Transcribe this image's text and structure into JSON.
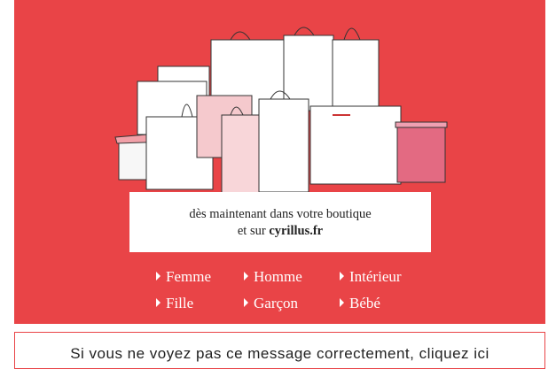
{
  "hero": {
    "background": "#e94447",
    "illustration": "shopping-bags-illustration"
  },
  "message": {
    "line1": "dès maintenant dans votre boutique",
    "line2_prefix": "et sur ",
    "line2_site": "cyrillus.fr"
  },
  "categories": [
    {
      "label": "Femme"
    },
    {
      "label": "Homme"
    },
    {
      "label": "Intérieur"
    },
    {
      "label": "Fille"
    },
    {
      "label": "Garçon"
    },
    {
      "label": "Bébé"
    }
  ],
  "footer": {
    "text": "Si vous ne voyez pas ce message correctement, cliquez ici"
  }
}
